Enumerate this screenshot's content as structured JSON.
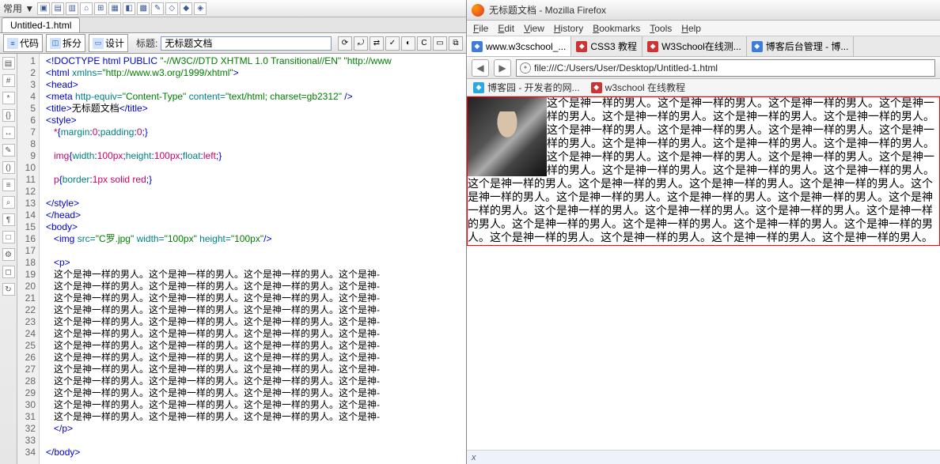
{
  "left": {
    "top_label": "常用 ▼",
    "top_icons": [
      "▣",
      "▤",
      "▥",
      "⌂",
      "⊞",
      "▦",
      "◧",
      "▩",
      "✎",
      "◇",
      "◆",
      "◈"
    ],
    "doc_tab": "Untitled-1.html",
    "mode_code": "代码",
    "mode_split": "拆分",
    "mode_design": "设计",
    "title_label": "标题:",
    "title_value": "无标题文档",
    "tool_icons": [
      "⟳",
      "⤾",
      "⇄",
      "✓",
      "◐",
      "C",
      "▭",
      "⧉"
    ],
    "vtool": [
      "▤",
      "#",
      "*",
      "{}",
      "↔",
      "✎",
      "()",
      "≡",
      "⌕",
      "¶",
      "□",
      "⚙",
      "◻",
      "↻"
    ],
    "code_lines": [
      {
        "n": 1,
        "spans": [
          {
            "c": "c-blue",
            "t": "<!DOCTYPE html PUBLIC "
          },
          {
            "c": "c-green",
            "t": "\"-//W3C//DTD XHTML 1.0 Transitional//EN\" \"http://www"
          }
        ]
      },
      {
        "n": 2,
        "spans": [
          {
            "c": "c-blue",
            "t": "<html "
          },
          {
            "c": "c-teal",
            "t": "xmlns="
          },
          {
            "c": "c-green",
            "t": "\"http://www.w3.org/1999/xhtml\""
          },
          {
            "c": "c-blue",
            "t": ">"
          }
        ]
      },
      {
        "n": 3,
        "spans": [
          {
            "c": "c-blue",
            "t": "<head>"
          }
        ]
      },
      {
        "n": 4,
        "spans": [
          {
            "c": "c-blue",
            "t": "<meta "
          },
          {
            "c": "c-teal",
            "t": "http-equiv="
          },
          {
            "c": "c-green",
            "t": "\"Content-Type\""
          },
          {
            "c": "c-teal",
            "t": " content="
          },
          {
            "c": "c-green",
            "t": "\"text/html; charset=gb2312\""
          },
          {
            "c": "c-blue",
            "t": " />"
          }
        ]
      },
      {
        "n": 5,
        "spans": [
          {
            "c": "c-blue",
            "t": "<title>"
          },
          {
            "c": "c-black",
            "t": "无标题文档"
          },
          {
            "c": "c-blue",
            "t": "</title>"
          }
        ]
      },
      {
        "n": 6,
        "spans": [
          {
            "c": "c-blue",
            "t": "<style>"
          }
        ]
      },
      {
        "n": 7,
        "spans": [
          {
            "c": "c-pink",
            "t": "   *"
          },
          {
            "c": "c-blue",
            "t": "{"
          },
          {
            "c": "c-teal",
            "t": "margin"
          },
          {
            "c": "c-blue",
            "t": ":"
          },
          {
            "c": "c-pink",
            "t": "0"
          },
          {
            "c": "c-blue",
            "t": ";"
          },
          {
            "c": "c-teal",
            "t": "padding"
          },
          {
            "c": "c-blue",
            "t": ":"
          },
          {
            "c": "c-pink",
            "t": "0"
          },
          {
            "c": "c-blue",
            "t": ";}"
          }
        ]
      },
      {
        "n": 8,
        "spans": []
      },
      {
        "n": 9,
        "spans": [
          {
            "c": "c-pink",
            "t": "   img"
          },
          {
            "c": "c-blue",
            "t": "{"
          },
          {
            "c": "c-teal",
            "t": "width"
          },
          {
            "c": "c-blue",
            "t": ":"
          },
          {
            "c": "c-pink",
            "t": "100px"
          },
          {
            "c": "c-blue",
            "t": ";"
          },
          {
            "c": "c-teal",
            "t": "height"
          },
          {
            "c": "c-blue",
            "t": ":"
          },
          {
            "c": "c-pink",
            "t": "100px"
          },
          {
            "c": "c-blue",
            "t": ";"
          },
          {
            "c": "c-teal",
            "t": "float"
          },
          {
            "c": "c-blue",
            "t": ":"
          },
          {
            "c": "c-pink",
            "t": "left"
          },
          {
            "c": "c-blue",
            "t": ";}"
          }
        ]
      },
      {
        "n": 10,
        "spans": []
      },
      {
        "n": 11,
        "spans": [
          {
            "c": "c-pink",
            "t": "   p"
          },
          {
            "c": "c-blue",
            "t": "{"
          },
          {
            "c": "c-teal",
            "t": "border"
          },
          {
            "c": "c-blue",
            "t": ":"
          },
          {
            "c": "c-pink",
            "t": "1px solid red"
          },
          {
            "c": "c-blue",
            "t": ";}"
          }
        ]
      },
      {
        "n": 12,
        "spans": []
      },
      {
        "n": 13,
        "spans": [
          {
            "c": "c-blue",
            "t": "</style>"
          }
        ]
      },
      {
        "n": 14,
        "spans": [
          {
            "c": "c-blue",
            "t": "</head>"
          }
        ]
      },
      {
        "n": 15,
        "spans": [
          {
            "c": "c-blue",
            "t": "<body>"
          }
        ]
      },
      {
        "n": 16,
        "spans": [
          {
            "c": "c-blue",
            "t": "   <img "
          },
          {
            "c": "c-teal",
            "t": "src="
          },
          {
            "c": "c-green",
            "t": "\"C罗.jpg\""
          },
          {
            "c": "c-teal",
            "t": " width="
          },
          {
            "c": "c-green",
            "t": "\"100px\""
          },
          {
            "c": "c-teal",
            "t": " height="
          },
          {
            "c": "c-green",
            "t": "\"100px\""
          },
          {
            "c": "c-blue",
            "t": "/>"
          }
        ]
      },
      {
        "n": 17,
        "spans": []
      },
      {
        "n": 18,
        "spans": [
          {
            "c": "c-blue",
            "t": "   <p>"
          }
        ]
      },
      {
        "n": 19,
        "spans": [
          {
            "c": "c-black",
            "t": "   这个是神一样的男人。这个是神一样的男人。这个是神一样的男人。这个是神-"
          }
        ]
      },
      {
        "n": 20,
        "spans": [
          {
            "c": "c-black",
            "t": "   这个是神一样的男人。这个是神一样的男人。这个是神一样的男人。这个是神-"
          }
        ]
      },
      {
        "n": 21,
        "spans": [
          {
            "c": "c-black",
            "t": "   这个是神一样的男人。这个是神一样的男人。这个是神一样的男人。这个是神-"
          }
        ]
      },
      {
        "n": 22,
        "spans": [
          {
            "c": "c-black",
            "t": "   这个是神一样的男人。这个是神一样的男人。这个是神一样的男人。这个是神-"
          }
        ]
      },
      {
        "n": 23,
        "spans": [
          {
            "c": "c-black",
            "t": "   这个是神一样的男人。这个是神一样的男人。这个是神一样的男人。这个是神-"
          }
        ]
      },
      {
        "n": 24,
        "spans": [
          {
            "c": "c-black",
            "t": "   这个是神一样的男人。这个是神一样的男人。这个是神一样的男人。这个是神-"
          }
        ]
      },
      {
        "n": 25,
        "spans": [
          {
            "c": "c-black",
            "t": "   这个是神一样的男人。这个是神一样的男人。这个是神一样的男人。这个是神-"
          }
        ]
      },
      {
        "n": 26,
        "spans": [
          {
            "c": "c-black",
            "t": "   这个是神一样的男人。这个是神一样的男人。这个是神一样的男人。这个是神-"
          }
        ]
      },
      {
        "n": 27,
        "spans": [
          {
            "c": "c-black",
            "t": "   这个是神一样的男人。这个是神一样的男人。这个是神一样的男人。这个是神-"
          }
        ]
      },
      {
        "n": 28,
        "spans": [
          {
            "c": "c-black",
            "t": "   这个是神一样的男人。这个是神一样的男人。这个是神一样的男人。这个是神-"
          }
        ]
      },
      {
        "n": 29,
        "spans": [
          {
            "c": "c-black",
            "t": "   这个是神一样的男人。这个是神一样的男人。这个是神一样的男人。这个是神-"
          }
        ]
      },
      {
        "n": 30,
        "spans": [
          {
            "c": "c-black",
            "t": "   这个是神一样的男人。这个是神一样的男人。这个是神一样的男人。这个是神-"
          }
        ]
      },
      {
        "n": 31,
        "spans": [
          {
            "c": "c-black",
            "t": "   这个是神一样的男人。这个是神一样的男人。这个是神一样的男人。这个是神-"
          }
        ]
      },
      {
        "n": 32,
        "spans": [
          {
            "c": "c-blue",
            "t": "   </p>"
          }
        ]
      },
      {
        "n": 33,
        "spans": []
      },
      {
        "n": 34,
        "spans": [
          {
            "c": "c-blue",
            "t": "</body>"
          }
        ]
      }
    ]
  },
  "right": {
    "window_title": "无标题文档 - Mozilla Firefox",
    "menubar": [
      "File",
      "Edit",
      "View",
      "History",
      "Bookmarks",
      "Tools",
      "Help"
    ],
    "tabs": [
      {
        "label": "www.w3cschool_...",
        "color": "#3b7dd8",
        "active": true
      },
      {
        "label": "CSS3 教程",
        "color": "#c33",
        "active": false
      },
      {
        "label": "W3School在线测...",
        "color": "#c33",
        "active": false
      },
      {
        "label": "博客后台管理 - 博...",
        "color": "#3b7dd8",
        "active": false
      }
    ],
    "url": "file:///C:/Users/User/Desktop/Untitled-1.html",
    "bookmarks": [
      {
        "label": "博客园 - 开发者的网...",
        "color": "#2aa9e0"
      },
      {
        "label": "w3school 在线教程",
        "color": "#c33"
      }
    ],
    "sentence": "这个是神一样的男人。",
    "repeat": 42,
    "status_x": "x"
  }
}
